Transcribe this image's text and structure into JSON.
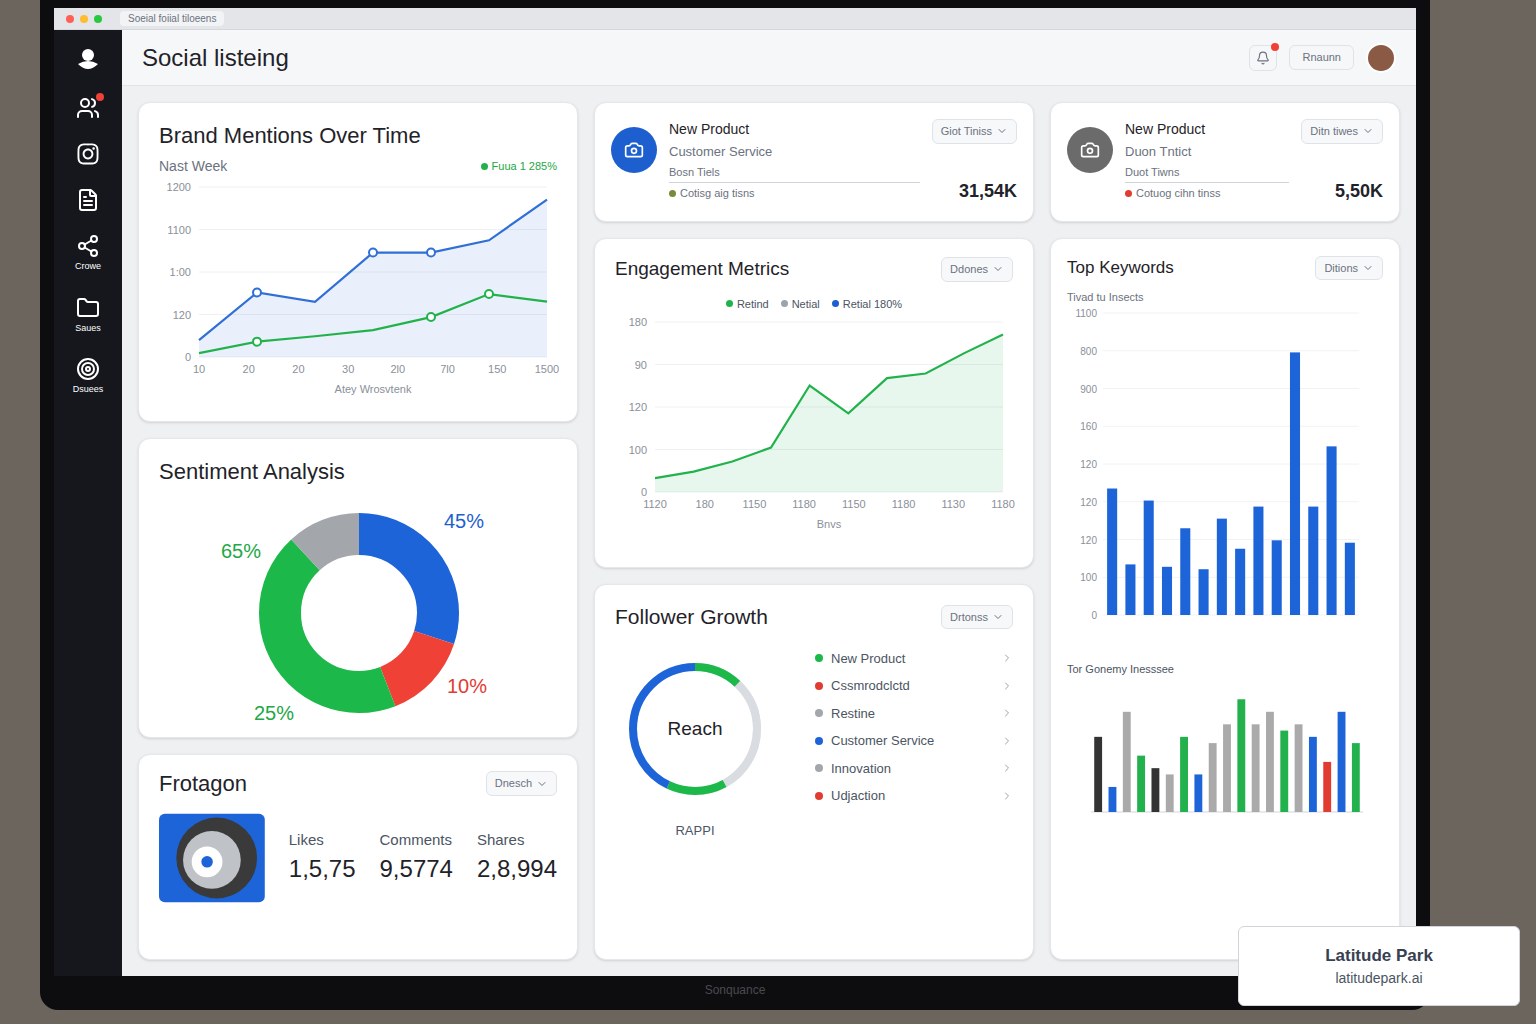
{
  "browser": {
    "title": "Soeial foiial tiloeens"
  },
  "sidebar": {
    "items": [
      {
        "badge": false
      },
      {
        "badge": true
      },
      {
        "badge": false
      },
      {
        "badge": false
      },
      {
        "label": "Crowe",
        "badge": false
      },
      {
        "label": "Saues",
        "badge": false
      },
      {
        "label": "Dsuees",
        "badge": false
      }
    ]
  },
  "header": {
    "title": "Social listeing",
    "notification": true,
    "button": "Rnaunn"
  },
  "brand_mentions": {
    "title": "Brand Mentions Over Time",
    "period": "Nast Week",
    "legend": "Fuua 1 285%",
    "y_ticks": [
      "1200",
      "1100",
      "1:00",
      "120",
      "0"
    ],
    "x_ticks": [
      "10",
      "20",
      "20",
      "30",
      "2l0",
      "7l0",
      "150",
      "1500"
    ],
    "x_label": "Atey Wrosvtenk",
    "series": [
      {
        "color": "#2f6fd6",
        "values": [
          22,
          84,
          72,
          136,
          136,
          152,
          205
        ],
        "marked": [
          1,
          3,
          4
        ]
      },
      {
        "color": "#22b24c",
        "values": [
          5,
          20,
          27,
          35,
          52,
          82,
          72
        ],
        "marked": [
          1,
          4,
          5
        ]
      }
    ]
  },
  "stat_cards": [
    {
      "title": "New Product",
      "subtitle": "Customer Service",
      "line": "Bosn Tiels",
      "note": "Cotisg aig tisns",
      "note_color": "#7a8a3a",
      "dropdown": "Giot Tiniss",
      "value": "31,54K",
      "icon_color": "#1d5fcf"
    },
    {
      "title": "New Product",
      "subtitle": "Duon Tntict",
      "line": "Duot Tiwns",
      "note": "Cotuog cihn tinss",
      "note_color": "#e03c31",
      "dropdown": "Ditn tiwes",
      "value": "5,50K",
      "icon_color": "#6b6b6b"
    }
  ],
  "engagement": {
    "title": "Engagement Metrics",
    "dropdown": "Ddones",
    "legend": [
      {
        "label": "Retind",
        "color": "#22b24c"
      },
      {
        "label": "Netial",
        "color": "#9ca3af"
      },
      {
        "label": "Retial 180%",
        "color": "#1d5fcf"
      }
    ],
    "y_ticks": [
      "180",
      "90",
      "120",
      "100",
      "0"
    ],
    "x_ticks": [
      "1120",
      "180",
      "1150",
      "1180",
      "1150",
      "1180",
      "1130",
      "1180"
    ],
    "x_label": "Bnvs",
    "series": [
      {
        "color": "#22b24c",
        "values": [
          15,
          22,
          33,
          48,
          115,
          85,
          123,
          128,
          150,
          170
        ],
        "marked": []
      }
    ]
  },
  "keywords": {
    "title": "Top Keywords",
    "dropdown": "Ditions",
    "subtitle": "Tivad tu Insects",
    "y_ticks": [
      "1100",
      "800",
      "900",
      "160",
      "120",
      "120",
      "120",
      "100",
      "0"
    ],
    "bars": {
      "color": "#1d64d8",
      "values": [
        105,
        42,
        95,
        40,
        72,
        38,
        80,
        55,
        90,
        62,
        218,
        90,
        140,
        60
      ]
    },
    "title2": "Tor Gonemy Inesssee",
    "bars2": [
      {
        "value": 60,
        "color": "#333333"
      },
      {
        "value": 20,
        "color": "#1d64d8"
      },
      {
        "value": 80,
        "color": "#aaaaaa"
      },
      {
        "value": 45,
        "color": "#22b14c"
      },
      {
        "value": 35,
        "color": "#333333"
      },
      {
        "value": 30,
        "color": "#aaaaaa"
      },
      {
        "value": 60,
        "color": "#22b14c"
      },
      {
        "value": 30,
        "color": "#1d64d8"
      },
      {
        "value": 55,
        "color": "#aaaaaa"
      },
      {
        "value": 70,
        "color": "#aaaaaa"
      },
      {
        "value": 90,
        "color": "#22b14c"
      },
      {
        "value": 70,
        "color": "#aaaaaa"
      },
      {
        "value": 80,
        "color": "#aaaaaa"
      },
      {
        "value": 65,
        "color": "#22b14c"
      },
      {
        "value": 70,
        "color": "#aaaaaa"
      },
      {
        "value": 60,
        "color": "#1d64d8"
      },
      {
        "value": 40,
        "color": "#e03c31"
      },
      {
        "value": 80,
        "color": "#1d64d8"
      },
      {
        "value": 55,
        "color": "#22b14c"
      }
    ]
  },
  "sentiment": {
    "title": "Sentiment Analysis",
    "segments": [
      {
        "color": "#1d64d8",
        "share": 0.3
      },
      {
        "color": "#ef4136",
        "share": 0.14
      },
      {
        "color": "#1cb84a",
        "share": 0.44
      },
      {
        "color": "#a3a6ab",
        "share": 0.12
      }
    ],
    "labels": [
      {
        "text": "65%",
        "color": "#22a845"
      },
      {
        "text": "45%",
        "color": "#1d5fcf"
      },
      {
        "text": "10%",
        "color": "#e03c31"
      },
      {
        "text": "25%",
        "color": "#22a845"
      }
    ]
  },
  "post": {
    "title": "Frotagon",
    "dropdown": "Dnesch",
    "stats": [
      {
        "label": "Likes",
        "value": "1,5,75"
      },
      {
        "label": "Comments",
        "value": "9,5774"
      },
      {
        "label": "Shares",
        "value": "2,8,994"
      }
    ]
  },
  "follower_growth": {
    "title": "Follower Growth",
    "dropdown": "Drtonss",
    "center": "Reach",
    "caption": "RAPPI",
    "ring": [
      {
        "color": "#1cb84a",
        "share": 0.12
      },
      {
        "color": "#d9dce0",
        "share": 0.3
      },
      {
        "color": "#1cb84a",
        "share": 0.15
      },
      {
        "color": "#1d64d8",
        "share": 0.43
      }
    ],
    "legend": [
      {
        "label": "New Product",
        "color": "#1cb84a"
      },
      {
        "label": "Cssmrodclctd",
        "color": "#e03c31"
      },
      {
        "label": "Restine",
        "color": "#a3a6ab"
      },
      {
        "label": "Customer Service",
        "color": "#1d64d8"
      },
      {
        "label": "Innovation",
        "color": "#a3a6ab"
      },
      {
        "label": "Udjaction",
        "color": "#e03c31"
      }
    ]
  },
  "monitor": {
    "brand": "Sonquance"
  },
  "watermark": {
    "title": "Latitude Park",
    "url": "latitudepark.ai"
  }
}
